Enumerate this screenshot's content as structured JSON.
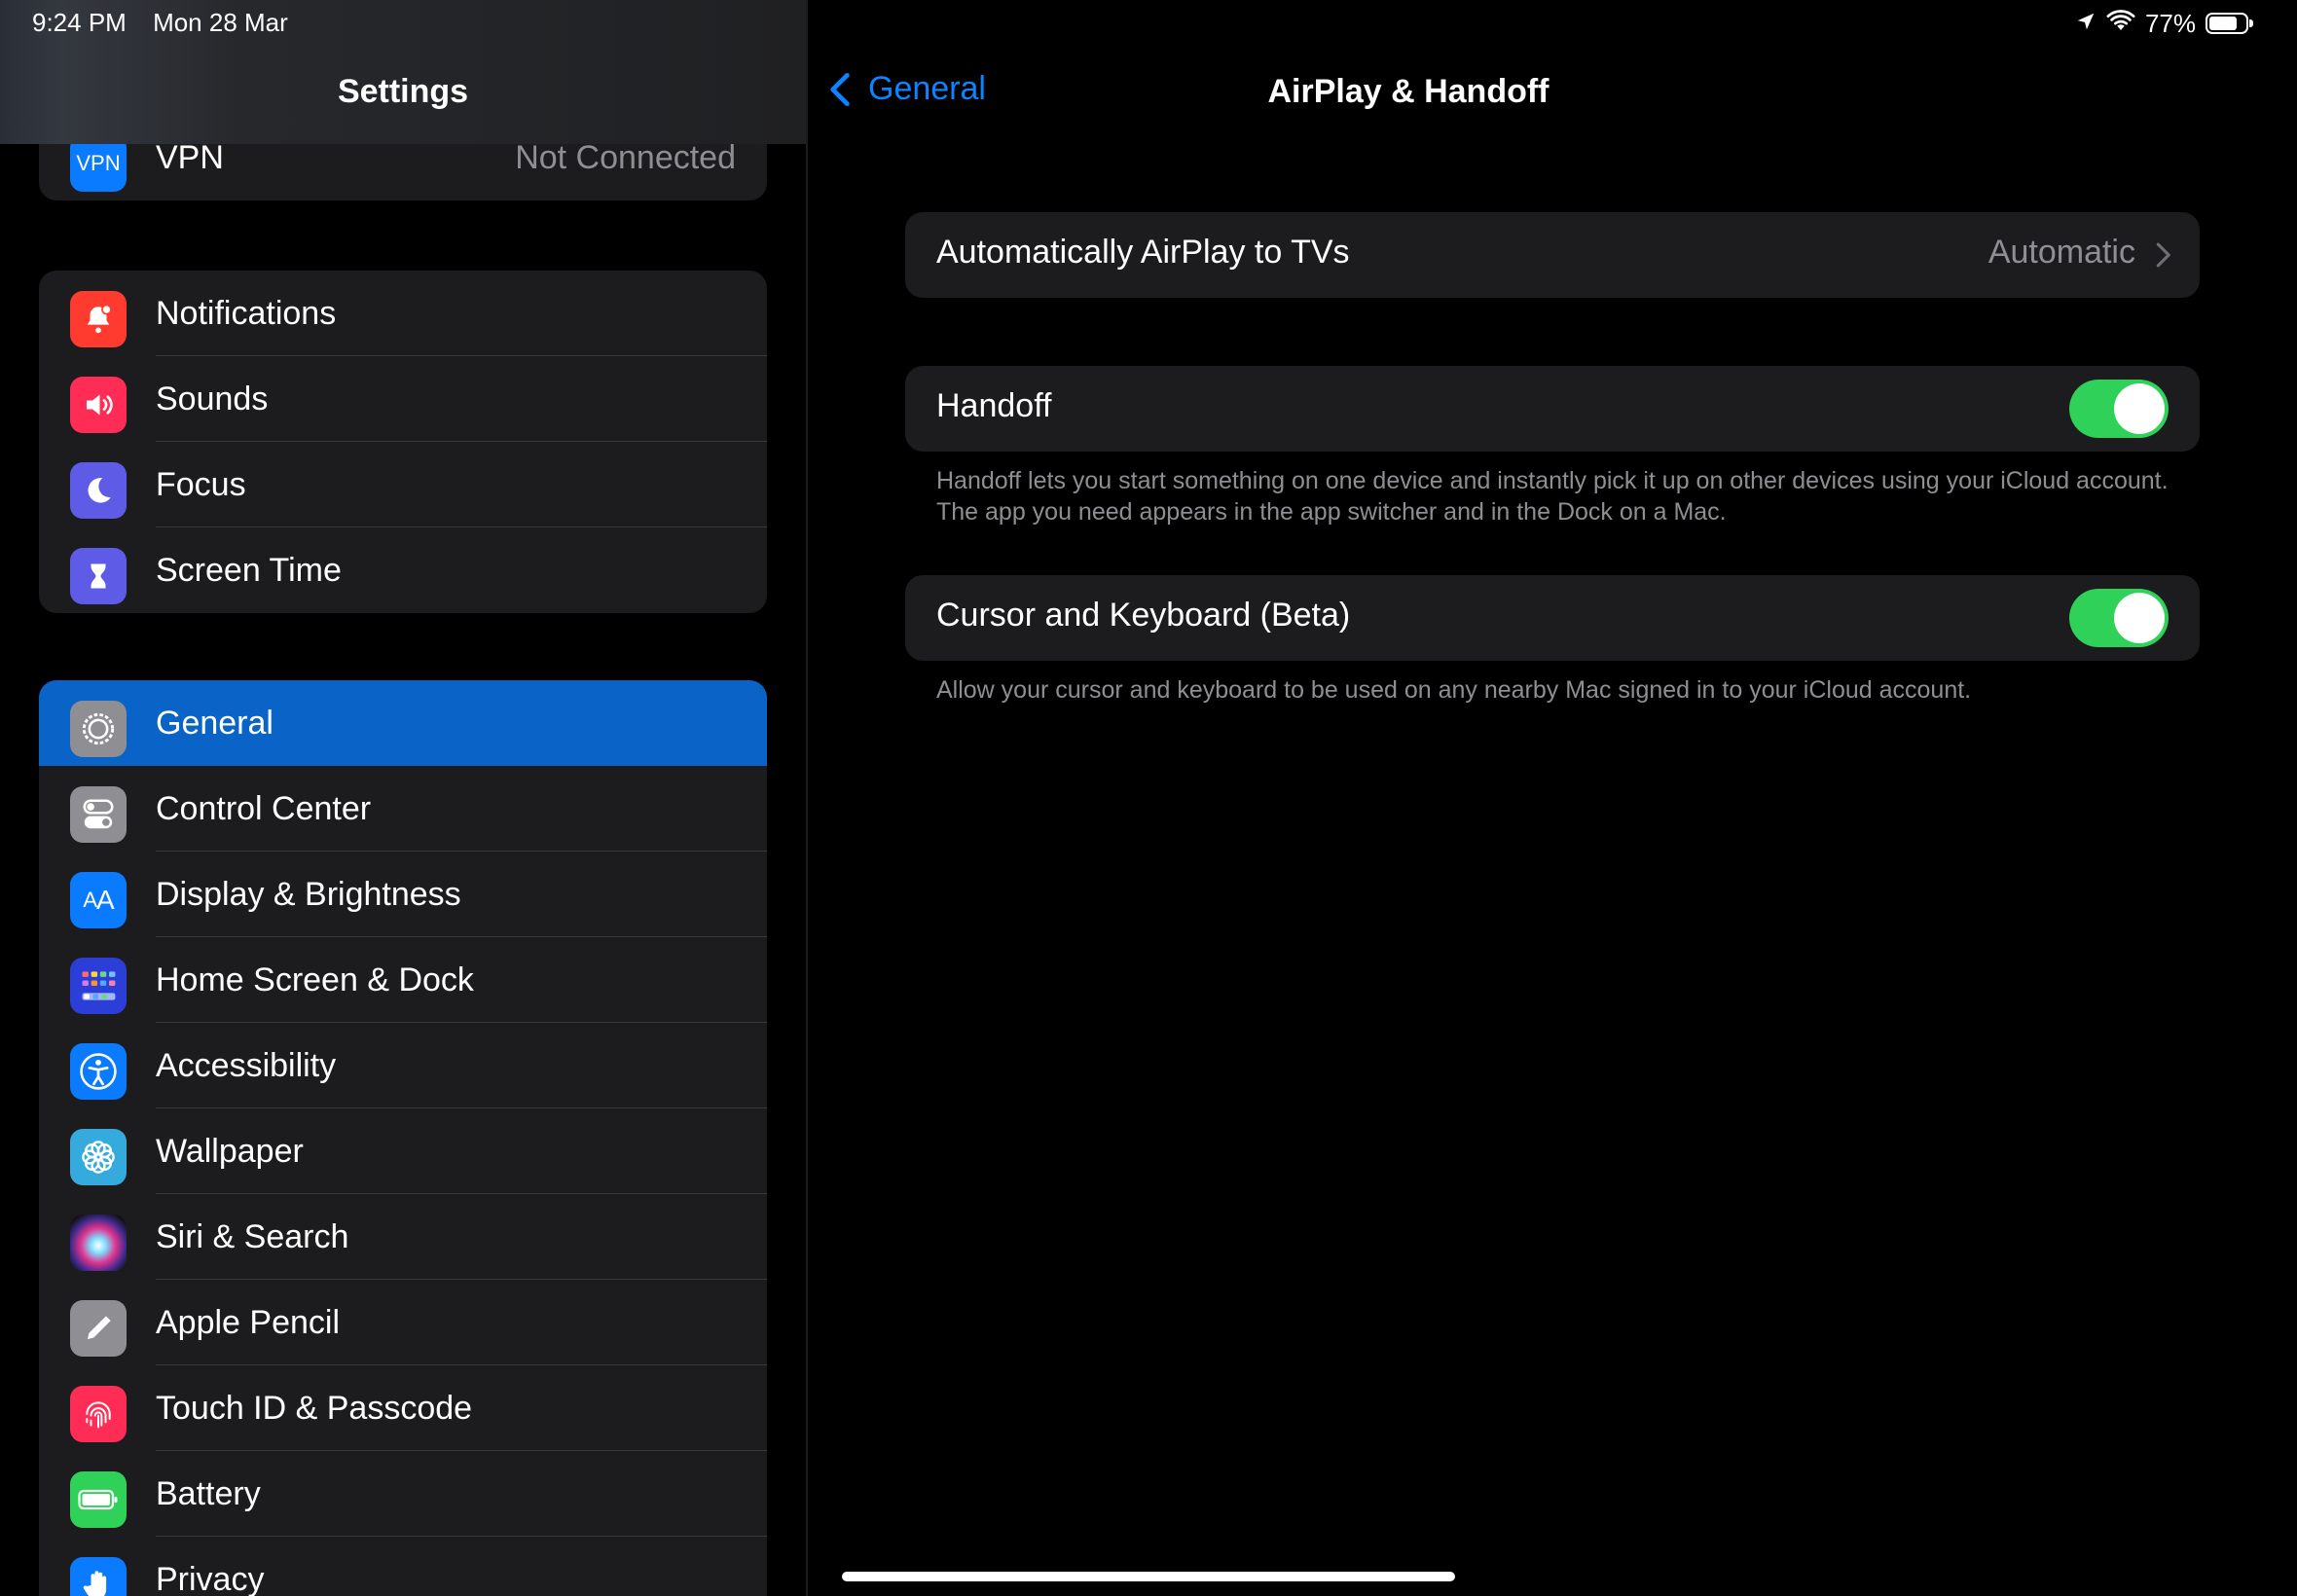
{
  "status_bar": {
    "time": "9:24 PM",
    "date": "Mon 28 Mar",
    "battery": "77%",
    "battery_level": 0.77
  },
  "sidebar": {
    "title": "Settings",
    "vpn": {
      "icon": "vpn-icon",
      "icon_text": "VPN",
      "label": "VPN",
      "value": "Not Connected",
      "color": "#0a7aff"
    },
    "group1": [
      {
        "icon": "bell-icon",
        "label": "Notifications",
        "color": "#ff3b30"
      },
      {
        "icon": "speaker-icon",
        "label": "Sounds",
        "color": "#ff2d55"
      },
      {
        "icon": "moon-icon",
        "label": "Focus",
        "color": "#5e5ce6"
      },
      {
        "icon": "hourglass-icon",
        "label": "Screen Time",
        "color": "#5e5ce6"
      }
    ],
    "group2": [
      {
        "icon": "gear-icon",
        "label": "General",
        "color": "#8e8e93",
        "selected": true
      },
      {
        "icon": "toggles-icon",
        "label": "Control Center",
        "color": "#8e8e93"
      },
      {
        "icon": "text-size-icon",
        "label": "Display & Brightness",
        "color": "#0a7aff"
      },
      {
        "icon": "app-grid-icon",
        "label": "Home Screen & Dock",
        "color": "#2c3ed8"
      },
      {
        "icon": "accessibility-icon",
        "label": "Accessibility",
        "color": "#0a7aff"
      },
      {
        "icon": "flower-icon",
        "label": "Wallpaper",
        "color": "#35aadc"
      },
      {
        "icon": "siri-icon",
        "label": "Siri & Search",
        "color": "#222"
      },
      {
        "icon": "pencil-icon",
        "label": "Apple Pencil",
        "color": "#8e8e93"
      },
      {
        "icon": "fingerprint-icon",
        "label": "Touch ID & Passcode",
        "color": "#ff2d55"
      },
      {
        "icon": "battery-icon",
        "label": "Battery",
        "color": "#30d158"
      },
      {
        "icon": "hand-icon",
        "label": "Privacy",
        "color": "#0a7aff"
      }
    ]
  },
  "detail": {
    "back_label": "General",
    "title": "AirPlay & Handoff",
    "airplay": {
      "label": "Automatically AirPlay to TVs",
      "value": "Automatic"
    },
    "handoff": {
      "label": "Handoff",
      "on": true,
      "footer": "Handoff lets you start something on one device and instantly pick it up on other devices using your iCloud account. The app you need appears in the app switcher and in the Dock on a Mac."
    },
    "cursor": {
      "label": "Cursor and Keyboard (Beta)",
      "on": true,
      "footer": "Allow your cursor and keyboard to be used on any nearby Mac signed in to your iCloud account."
    }
  }
}
